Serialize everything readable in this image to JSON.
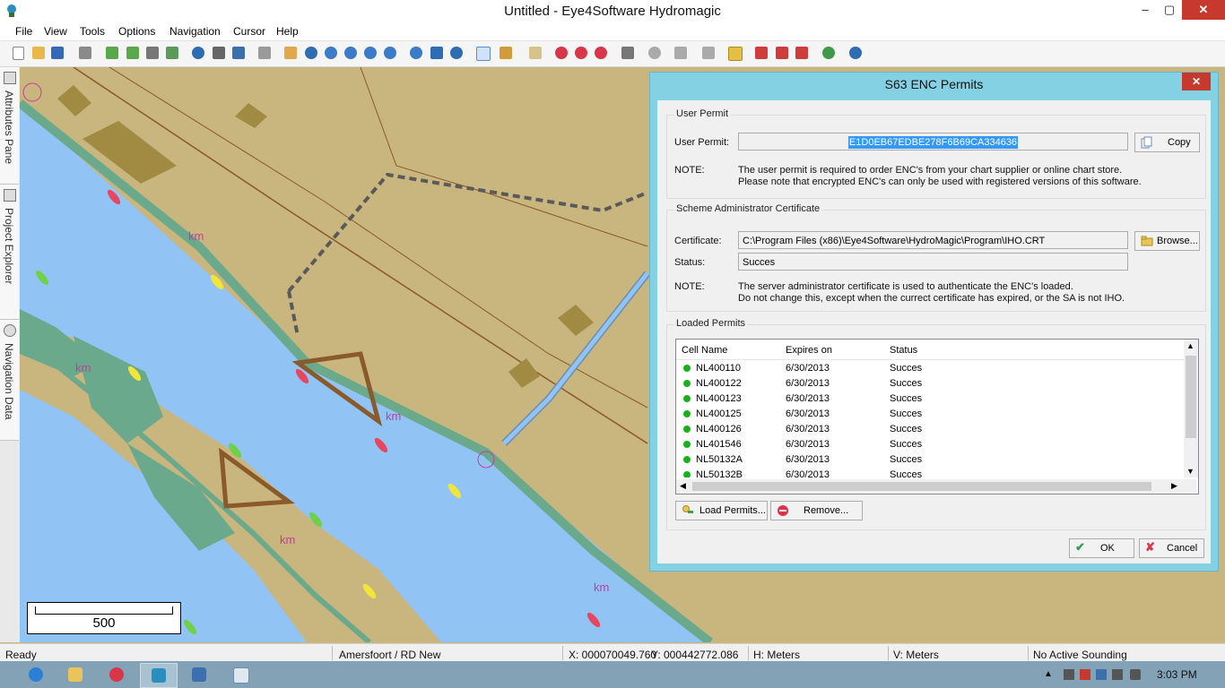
{
  "window": {
    "title": "Untitled - Eye4Software Hydromagic",
    "minimize_glyph": "–",
    "maximize_glyph": "▢",
    "close_glyph": "✕"
  },
  "menu": [
    "File",
    "View",
    "Tools",
    "Options",
    "Navigation",
    "Cursor",
    "Help"
  ],
  "toolbar_icons": [
    "new-icon",
    "open-icon",
    "save-icon",
    "print-icon",
    "add-chart-icon",
    "add-layer-icon",
    "grid-icon",
    "link-icon",
    "globe-icon",
    "disk-icon",
    "monitor-icon",
    "windows-icon",
    "pan-hand-icon",
    "info-icon",
    "zoom-in-icon",
    "zoom-out-icon",
    "zoom-fit-icon",
    "zoom-window-icon",
    "rotate-left-icon",
    "north-up-icon",
    "refresh-icon",
    "move-cursor-icon",
    "measure-icon",
    "annotate-icon",
    "target-a-icon",
    "target-b-icon",
    "target-c-icon",
    "tools-icon",
    "record-icon",
    "lightning-icon",
    "alarm-icon",
    "lock-icon",
    "route-a-icon",
    "route-b-icon",
    "route-c-icon",
    "chart-settings-icon",
    "help-icon"
  ],
  "side_tabs": [
    "Attributes Pane",
    "Project Explorer",
    "Navigation Data"
  ],
  "map": {
    "km_labels": [
      "km",
      "km",
      "km",
      "km",
      "km",
      "km"
    ],
    "scale_value": "500"
  },
  "colors": {
    "land": "#c9b57e",
    "water": "#91c4f5",
    "shore": "#6aa98b",
    "dialog_frame": "#85d1e4",
    "close_red": "#c7392d",
    "status_green": "#19b119"
  },
  "dialog": {
    "title": "S63 ENC Permits",
    "close_glyph": "✕",
    "user_permit": {
      "group": "User Permit",
      "label": "User Permit:",
      "value": "E1D0EB67EDBE278F6B69CA334636",
      "copy_label": "Copy",
      "note_label": "NOTE:",
      "note_line1": "The user permit is required to order ENC's from your chart supplier or online chart store.",
      "note_line2": "Please note that encrypted ENC's can only be used with registered versions of this software."
    },
    "certificate": {
      "group": "Scheme Administrator Certificate",
      "cert_label": "Certificate:",
      "cert_value": "C:\\Program Files (x86)\\Eye4Software\\HydroMagic\\Program\\IHO.CRT",
      "browse_label": "Browse...",
      "status_label": "Status:",
      "status_value": "Succes",
      "note_label": "NOTE:",
      "note_line1": "The server administrator certificate is used to authenticate the ENC's loaded.",
      "note_line2": "Do not change this, except when the currect certificate has expired, or the SA is not IHO."
    },
    "permits": {
      "group": "Loaded Permits",
      "headers": [
        "Cell Name",
        "Expires on",
        "Status"
      ],
      "rows": [
        {
          "cell": "NL400110",
          "expires": "6/30/2013",
          "status": "Succes"
        },
        {
          "cell": "NL400122",
          "expires": "6/30/2013",
          "status": "Succes"
        },
        {
          "cell": "NL400123",
          "expires": "6/30/2013",
          "status": "Succes"
        },
        {
          "cell": "NL400125",
          "expires": "6/30/2013",
          "status": "Succes"
        },
        {
          "cell": "NL400126",
          "expires": "6/30/2013",
          "status": "Succes"
        },
        {
          "cell": "NL401546",
          "expires": "6/30/2013",
          "status": "Succes"
        },
        {
          "cell": "NL50132A",
          "expires": "6/30/2013",
          "status": "Succes"
        },
        {
          "cell": "NL50132B",
          "expires": "6/30/2013",
          "status": "Succes"
        }
      ],
      "load_label": "Load Permits...",
      "remove_label": "Remove..."
    },
    "ok_label": "OK",
    "cancel_label": "Cancel"
  },
  "status": {
    "ready": "Ready",
    "projection": "Amersfoort / RD New",
    "x": "X: 000070049.760",
    "y": "Y: 000442772.086",
    "h_units": "H: Meters",
    "v_units": "V: Meters",
    "sounding": "No Active Sounding"
  },
  "taskbar": {
    "apps": [
      "internet-explorer-icon",
      "file-explorer-icon",
      "app-red-icon",
      "hydromagic-icon",
      "remote-desktop-icon",
      "notepad-icon"
    ],
    "tray_icons": [
      "tray-arrow-icon",
      "network-icon",
      "flag-icon",
      "display-icon",
      "battery-icon",
      "volume-muted-icon"
    ],
    "time": "3:03 PM"
  }
}
